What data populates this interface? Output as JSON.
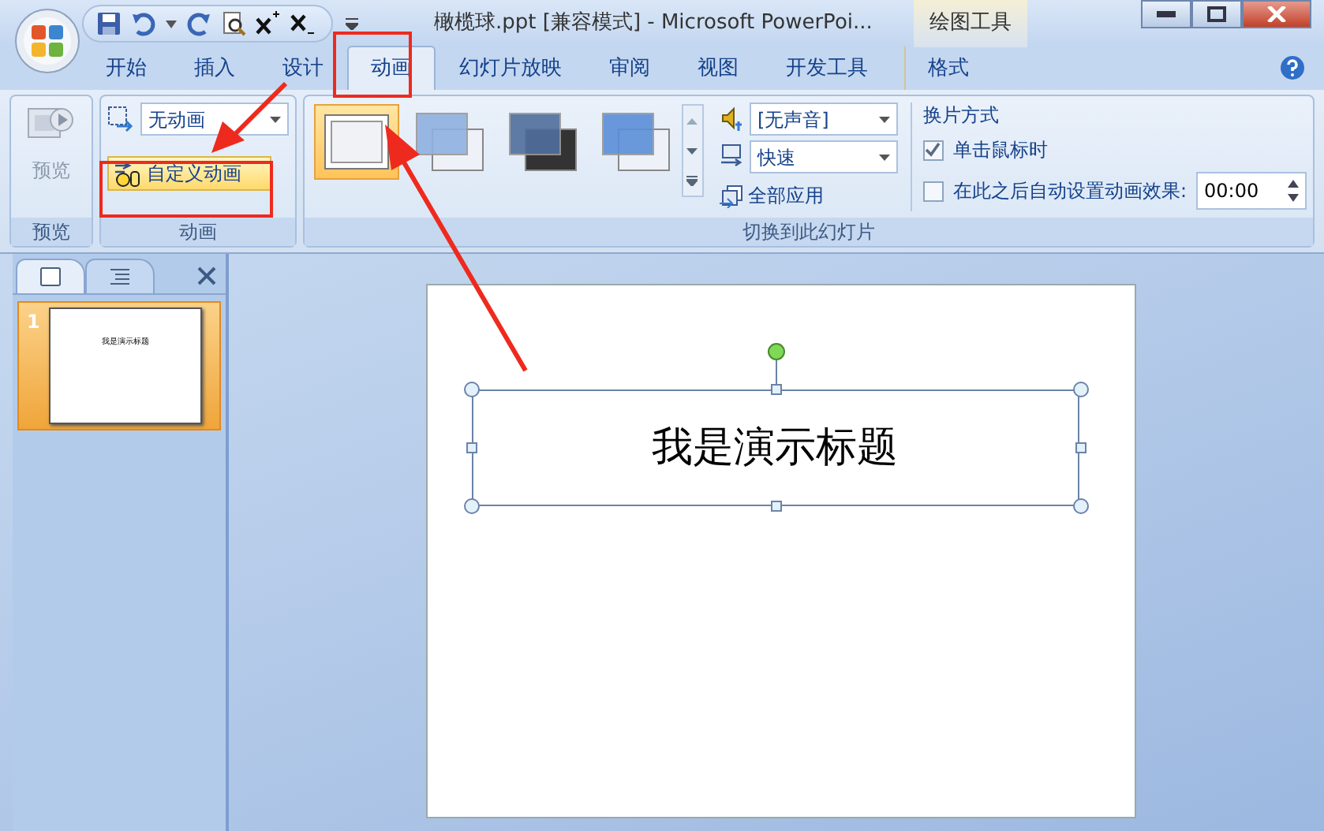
{
  "window": {
    "title": "橄榄球.ppt [兼容模式] - Microsoft PowerPoi...",
    "contextual_group": "绘图工具"
  },
  "ribbon_tabs": [
    {
      "label": "开始",
      "selected": false,
      "contextual": false
    },
    {
      "label": "插入",
      "selected": false,
      "contextual": false
    },
    {
      "label": "设计",
      "selected": false,
      "contextual": false
    },
    {
      "label": "动画",
      "selected": true,
      "contextual": false
    },
    {
      "label": "幻灯片放映",
      "selected": false,
      "contextual": false
    },
    {
      "label": "审阅",
      "selected": false,
      "contextual": false
    },
    {
      "label": "视图",
      "selected": false,
      "contextual": false
    },
    {
      "label": "开发工具",
      "selected": false,
      "contextual": false
    },
    {
      "label": "格式",
      "selected": false,
      "contextual": true
    }
  ],
  "preview_group": {
    "button": "预览",
    "disabled": true,
    "label": "预览"
  },
  "animation_group": {
    "animation_select": "无动画",
    "custom_animation_button": "自定义动画",
    "label": "动画"
  },
  "transition_group": {
    "label": "切换到此幻灯片",
    "thumbnails": [
      {
        "kind": "none",
        "selected": true
      },
      {
        "kind": "fade",
        "selected": false
      },
      {
        "kind": "dark",
        "selected": false
      },
      {
        "kind": "blue",
        "selected": false
      }
    ],
    "sound_select": "[无声音]",
    "speed_select": "快速",
    "apply_all": "全部应用",
    "advance_heading": "换片方式",
    "on_click": {
      "label": "单击鼠标时",
      "checked": true
    },
    "after": {
      "label": "在此之后自动设置动画效果:",
      "checked": false,
      "value": "00:00"
    }
  },
  "slides_panel": {
    "tabs": [
      {
        "kind": "slides",
        "selected": true
      },
      {
        "kind": "outline",
        "selected": false
      }
    ],
    "slides": [
      {
        "number": "1",
        "title": "我是演示标题",
        "selected": true
      }
    ]
  },
  "slide": {
    "title": "我是演示标题",
    "selected": true
  }
}
